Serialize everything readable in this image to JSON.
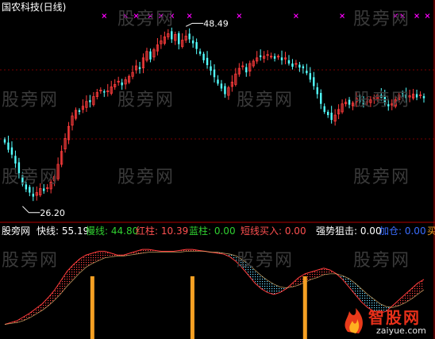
{
  "title": "国农科技(日线)",
  "watermarks": [
    "股旁网",
    "股旁网",
    "股旁网",
    "股旁网",
    "股旁网",
    "股旁网",
    "股旁网",
    "股旁网",
    "股旁网",
    "股旁网",
    "股旁网",
    "股旁网"
  ],
  "brand": {
    "name": "智股网",
    "url": "zaiyue.com"
  },
  "colors": {
    "background": "#000000",
    "up_candle": "#ff3c3c",
    "down_candle": "#54ffff",
    "grid": "#7a0000",
    "marker": "#ff00ff",
    "bar": "#f5a023"
  },
  "indicator": {
    "prefix": "股旁网",
    "fields": [
      {
        "label": "快线:",
        "value": "55.19",
        "color": "#ffffff"
      },
      {
        "label": "慢线:",
        "value": "44.80",
        "color": "#30d030"
      },
      {
        "label": "红柱:",
        "value": "10.39",
        "color": "#ff5050"
      },
      {
        "label": "蓝柱:",
        "value": "0.00",
        "color": "#30d030"
      },
      {
        "label": "短线买入:",
        "value": "0.00",
        "color": "#ff5050"
      },
      {
        "label": "强势狙击:",
        "value": "0.00",
        "color": "#ffffff"
      },
      {
        "label": "加仓:",
        "value": "0.00",
        "color": "#3a6dff"
      },
      {
        "label": "买",
        "value": "",
        "color": "#f5a023"
      }
    ]
  },
  "chart_data": [
    {
      "type": "candlestick",
      "title": "国农科技(日线)",
      "ylim": [
        25,
        50
      ],
      "annotations": [
        {
          "text": "48.49",
          "kind": "max",
          "x_index": 51,
          "value": 48.49
        },
        {
          "text": "26.20",
          "kind": "min",
          "x_index": 5,
          "value": 26.2
        }
      ],
      "marker_indices": [
        28,
        34,
        37,
        41,
        44,
        47,
        52,
        66,
        82,
        95,
        110,
        112,
        116,
        119
      ],
      "closes": [
        34.1,
        33.2,
        32.6,
        31.5,
        30.3,
        28.9,
        28.3,
        27.9,
        27.4,
        27.9,
        28.4,
        28.1,
        28.5,
        29.2,
        29.9,
        31.4,
        33.0,
        34.6,
        36.1,
        37.4,
        38.1,
        37.9,
        38.6,
        39.2,
        39.1,
        39.8,
        40.3,
        40.6,
        40.3,
        40.5,
        41.0,
        41.3,
        41.7,
        41.2,
        41.9,
        42.3,
        42.8,
        43.6,
        43.2,
        44.6,
        45.4,
        44.4,
        45.6,
        46.2,
        46.7,
        47.2,
        47.6,
        46.9,
        47.5,
        46.3,
        46.8,
        47.3,
        46.9,
        46.4,
        45.7,
        45.1,
        44.3,
        43.7,
        43.0,
        42.2,
        41.4,
        40.8,
        40.1,
        40.9,
        41.6,
        42.6,
        43.3,
        43.6,
        42.8,
        43.9,
        44.2,
        44.6,
        44.7,
        44.8,
        45.0,
        44.8,
        44.5,
        44.8,
        44.3,
        44.6,
        43.9,
        43.5,
        43.9,
        43.4,
        43.3,
        42.7,
        41.9,
        41.1,
        40.1,
        38.9,
        37.9,
        37.5,
        36.9,
        37.5,
        38.2,
        38.9,
        39.1,
        38.8,
        39.0,
        39.6,
        39.2,
        38.8,
        39.2,
        39.4,
        39.7,
        40.0,
        39.6,
        39.0,
        38.6,
        38.9,
        39.4,
        40.0,
        40.2,
        39.6,
        39.9,
        40.1,
        39.7,
        40.0,
        39.6
      ]
    },
    {
      "type": "line",
      "title": "股旁网",
      "series": [
        {
          "name": "快线",
          "values": [
            8,
            10,
            12,
            16,
            20,
            25,
            30,
            37,
            45,
            55,
            65,
            72,
            78,
            82,
            84,
            86,
            86,
            84,
            82,
            82,
            84,
            86,
            88,
            88,
            87,
            86,
            86,
            86,
            87,
            88,
            88,
            87,
            86,
            85,
            84,
            83,
            80,
            75,
            68,
            60,
            52,
            46,
            42,
            40,
            42,
            46,
            52,
            58,
            62,
            64,
            66,
            68,
            66,
            62,
            56,
            48,
            40,
            32,
            26,
            22,
            20,
            22,
            28,
            34,
            40,
            46,
            52,
            56
          ]
        },
        {
          "name": "慢线",
          "values": [
            8,
            9,
            10,
            12,
            15,
            19,
            23,
            28,
            34,
            41,
            49,
            56,
            63,
            69,
            73,
            76,
            79,
            80,
            81,
            81,
            82,
            83,
            84,
            85,
            85,
            85,
            85,
            85,
            85,
            86,
            86,
            86,
            86,
            85,
            85,
            84,
            83,
            81,
            77,
            72,
            66,
            60,
            55,
            51,
            48,
            47,
            48,
            50,
            53,
            56,
            58,
            61,
            62,
            62,
            60,
            57,
            52,
            46,
            40,
            35,
            30,
            27,
            26,
            28,
            31,
            35,
            40,
            45
          ]
        },
        {
          "name": "买",
          "kind": "bar",
          "x_indices": [
            14,
            30,
            48
          ]
        }
      ]
    }
  ]
}
